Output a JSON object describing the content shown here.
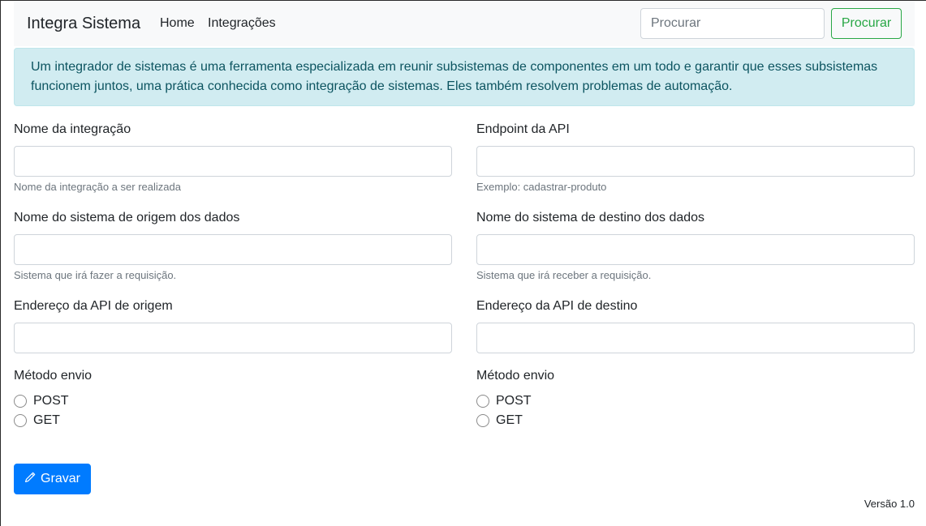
{
  "navbar": {
    "brand": "Integra Sistema",
    "links": [
      "Home",
      "Integrações"
    ],
    "search_placeholder": "Procurar",
    "search_button": "Procurar"
  },
  "alert": {
    "text": "Um integrador de sistemas é uma ferramenta especializada em reunir subsistemas de componentes em um todo e garantir que esses subsistemas funcionem juntos, uma prática conhecida como integração de sistemas. Eles também resolvem problemas de automação."
  },
  "form": {
    "nome_integracao": {
      "label": "Nome da integração",
      "value": "",
      "help": "Nome da integração a ser realizada"
    },
    "endpoint": {
      "label": "Endpoint da API",
      "value": "",
      "help": "Exemplo: cadastrar-produto"
    },
    "sistema_origem": {
      "label": "Nome do sistema de origem dos dados",
      "value": "",
      "help": "Sistema que irá fazer a requisição."
    },
    "sistema_destino": {
      "label": "Nome do sistema de destino dos dados",
      "value": "",
      "help": "Sistema que irá receber a requisição."
    },
    "api_origem": {
      "label": "Endereço da API de origem",
      "value": ""
    },
    "api_destino": {
      "label": "Endereço da API de destino",
      "value": ""
    },
    "metodo_origem": {
      "label": "Método envio",
      "options": [
        "POST",
        "GET"
      ],
      "selected": null
    },
    "metodo_destino": {
      "label": "Método envio",
      "options": [
        "POST",
        "GET"
      ],
      "selected": null
    },
    "save_button": {
      "label": "Gravar",
      "icon": "pencil-icon"
    }
  },
  "footer": {
    "version": "Versão 1.0"
  },
  "colors": {
    "primary": "#007bff",
    "success": "#28a745",
    "alert_bg": "#d1ecf1",
    "alert_text": "#0c5460"
  }
}
